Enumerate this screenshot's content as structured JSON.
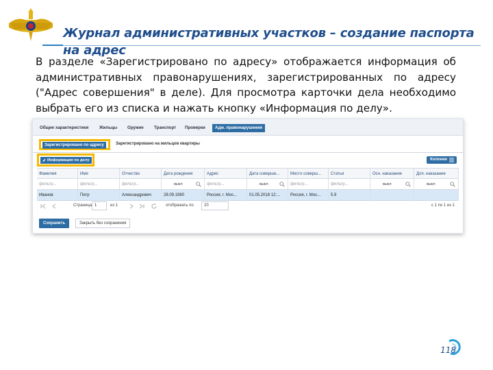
{
  "slide": {
    "title": "Журнал административных участков – создание паспорта на адрес",
    "body": "В разделе «Зарегистрировано по адресу» отображается информация об административных правонарушениях, зарегистрированных по адресу (\"Адрес совершения\" в деле). Для просмотра карточки дела необходимо выбрать его из списка и нажать кнопку «Информация по делу».",
    "page_number": "118"
  },
  "icons": [
    "emblem-eagle",
    "pencil-icon",
    "columns-menu-icon",
    "search-icon",
    "first-page-icon",
    "prev-page-icon",
    "next-page-icon",
    "last-page-icon",
    "refresh-icon"
  ],
  "colors": {
    "accent": "#1f4e8c",
    "tab_active": "#2e6da4",
    "highlight": "#f5b800",
    "row_selected": "#d8e8f7"
  },
  "screenshot": {
    "tabs": [
      {
        "label": "Общие характеристики"
      },
      {
        "label": "Жильцы"
      },
      {
        "label": "Оружие"
      },
      {
        "label": "Транспорт"
      },
      {
        "label": "Проверки"
      },
      {
        "label": "Адм. правонарушения",
        "active": true
      }
    ],
    "subtabs": {
      "active": "Зарегистрировано по адресу",
      "other": "Зарегистрировано на жильцов квартиры"
    },
    "toolbar": {
      "info_button": "Информация по делу",
      "columns_button": "Колонки"
    },
    "grid": {
      "columns": [
        "Фамилия",
        "Имя",
        "Отчество",
        "Дата рождения",
        "Адрес",
        "Дата соверше...",
        "Место соверш...",
        "Статья",
        "Осн. наказание",
        "Доп. наказание"
      ],
      "filters": {
        "text_placeholder": "фильтр...",
        "select_value": "выкл"
      },
      "rows": [
        [
          "Иванов",
          "Петр",
          "Александрович",
          "28.09.1980",
          "Россия, г. Мос...",
          "01.05.2018 12:...",
          "Россия, г. Мос...",
          "5.9",
          "",
          ""
        ]
      ]
    },
    "pager": {
      "page_label": "Страница",
      "page_value": "1",
      "of_label": "из 1",
      "show_label": "отображать по",
      "per_page": "20",
      "summary": "с 1 по 1 из 1"
    },
    "buttons": {
      "save": "Сохранить",
      "close": "Закрыть без сохранения"
    }
  }
}
